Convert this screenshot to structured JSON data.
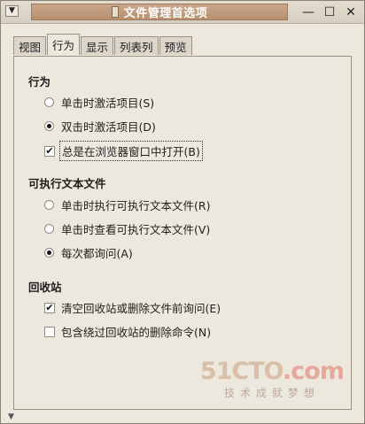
{
  "window": {
    "title": "文件管理首选项",
    "menu_glyph": "▼",
    "minimize_glyph": "—",
    "maximize_glyph": "☐",
    "close_glyph": "✕"
  },
  "tabs": [
    {
      "label": "视图",
      "active": false
    },
    {
      "label": "行为",
      "active": true
    },
    {
      "label": "显示",
      "active": false
    },
    {
      "label": "列表列",
      "active": false
    },
    {
      "label": "预览",
      "active": false
    }
  ],
  "behavior": {
    "title": "行为",
    "single_click": "单击时激活项目(S)",
    "double_click": "双击时激活项目(D)",
    "always_browser": "总是在浏览器窗口中打开(B)"
  },
  "executable": {
    "title": "可执行文本文件",
    "run": "单击时执行可执行文本文件(R)",
    "view": "单击时查看可执行文本文件(V)",
    "ask": "每次都询问(A)"
  },
  "trash": {
    "title": "回收站",
    "confirm_empty": "清空回收站或删除文件前询问(E)",
    "include_delete": "包含绕过回收站的删除命令(N)"
  },
  "state": {
    "click_mode": "double",
    "always_browser": true,
    "exec_mode": "ask",
    "confirm_empty": true,
    "include_delete": false
  },
  "watermark": {
    "logo_prefix": "51CTO",
    "logo_suffix": ".com",
    "tagline": "技术成就梦想"
  }
}
